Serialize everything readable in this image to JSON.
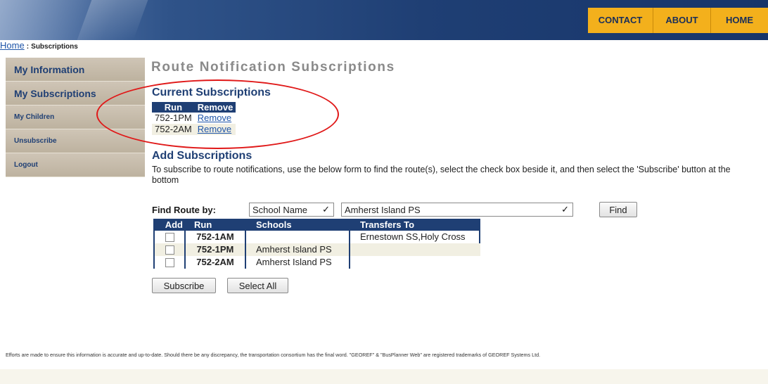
{
  "header": {
    "nav": [
      {
        "label": "CONTACT"
      },
      {
        "label": "ABOUT"
      },
      {
        "label": "HOME"
      }
    ]
  },
  "breadcrumb": {
    "home": "Home",
    "separator": ":",
    "current": "Subscriptions"
  },
  "sidebar": {
    "items": [
      {
        "label": "My Information"
      },
      {
        "label": "My Subscriptions"
      },
      {
        "label": "My Children"
      },
      {
        "label": "Unsubscribe"
      },
      {
        "label": "Logout"
      }
    ]
  },
  "main": {
    "title": "Route Notification Subscriptions",
    "current": {
      "heading": "Current Subscriptions",
      "columns": [
        "Run",
        "Remove"
      ],
      "rows": [
        {
          "run": "752-1PM",
          "action": "Remove"
        },
        {
          "run": "752-2AM",
          "action": "Remove"
        }
      ]
    },
    "add": {
      "heading": "Add Subscriptions",
      "instructions": "To subscribe to route notifications, use the below form to find the route(s), select the check box beside it, and then select the 'Subscribe' button at the bottom",
      "find_label": "Find Route by:",
      "find_by_value": "School Name",
      "school_value": "Amherst Island PS",
      "find_button": "Find",
      "columns": [
        "Add",
        "Run",
        "Schools",
        "Transfers To"
      ],
      "rows": [
        {
          "checked": false,
          "run": "752-1AM",
          "schools": "",
          "transfers": "Ernestown SS,Holy Cross"
        },
        {
          "checked": false,
          "run": "752-1PM",
          "schools": "Amherst Island PS",
          "transfers": ""
        },
        {
          "checked": false,
          "run": "752-2AM",
          "schools": "Amherst Island PS",
          "transfers": ""
        }
      ],
      "subscribe_button": "Subscribe",
      "select_all_button": "Select All"
    }
  },
  "footer": {
    "text": "Efforts are made to ensure this information is accurate and up-to-date. Should there be any discrepancy, the transportation consortium has the final word. \"GEOREF\" & \"BusPlanner Web\" are registered trademarks of GEOREF Systems Ltd."
  },
  "colors": {
    "header_blue": "#1f3f74",
    "nav_gold": "#f3b01c",
    "sidebar_tan": "#c7bdac",
    "annotation_red": "#e01818"
  }
}
